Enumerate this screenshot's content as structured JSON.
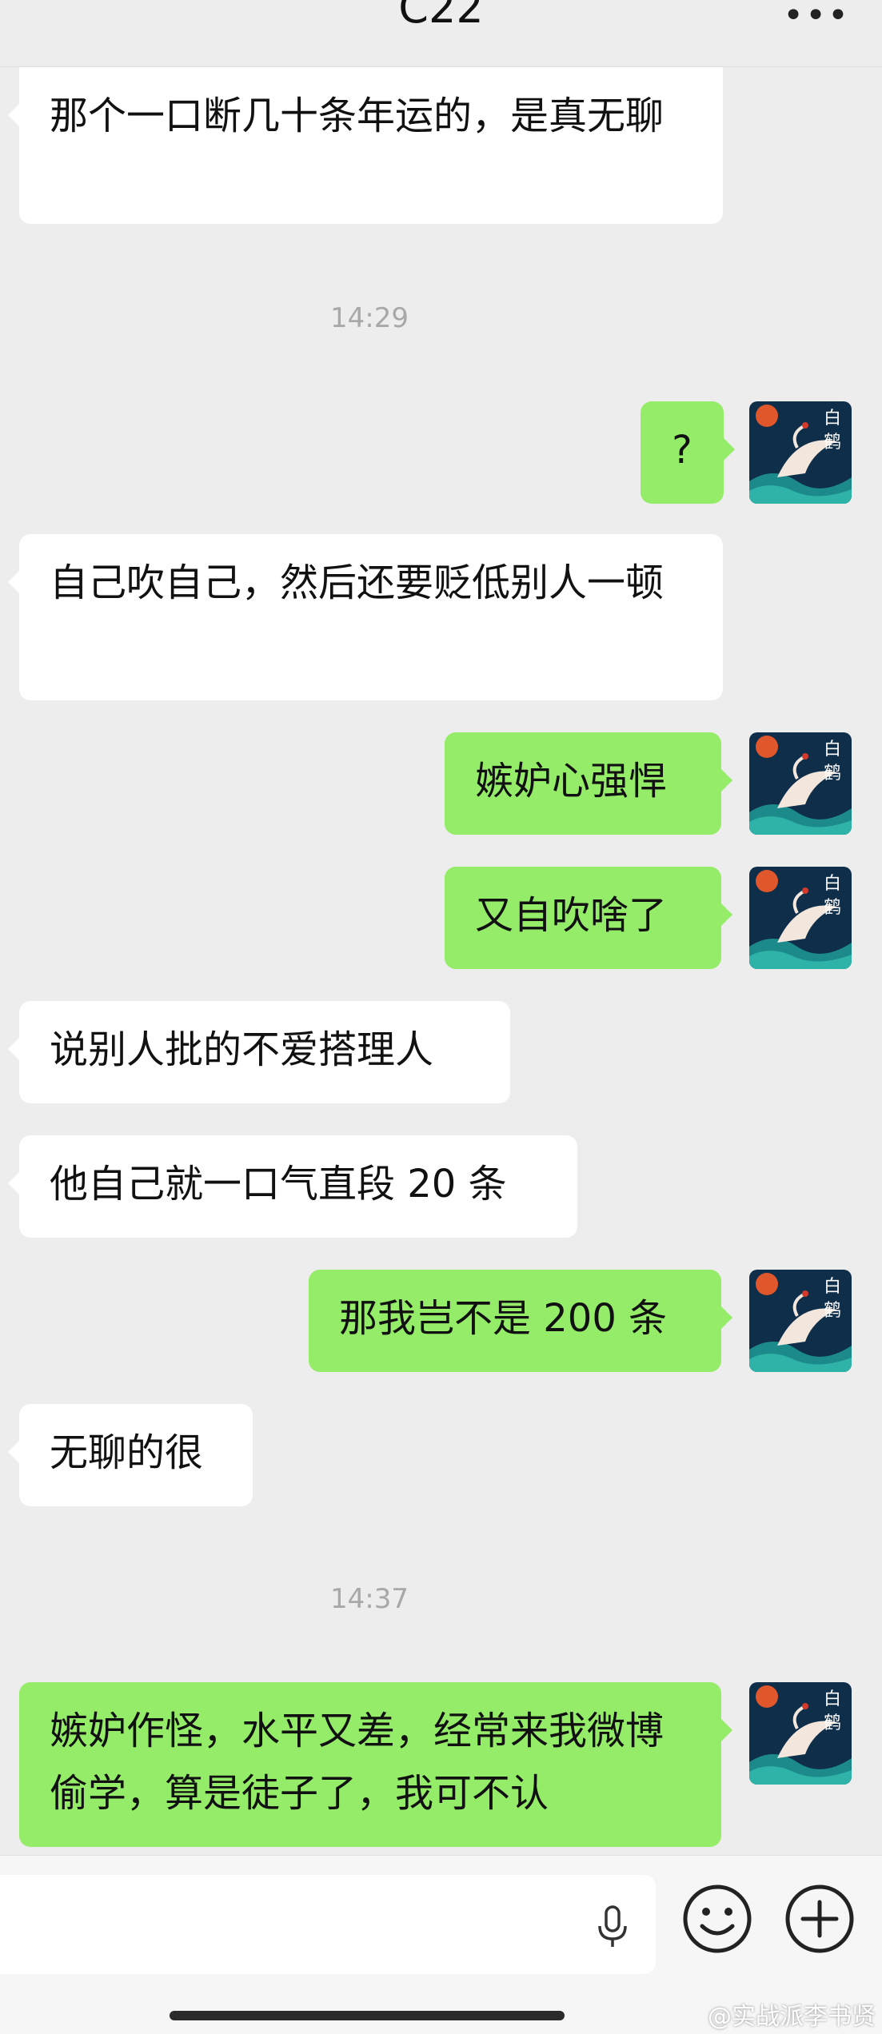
{
  "header": {
    "title": "C22",
    "more_icon": "more-dots-icon"
  },
  "messages": [
    {
      "text": "那个一口断几十条年运的，是真无聊",
      "from": "other"
    },
    {
      "time": "14:29"
    },
    {
      "text": "?",
      "from": "me"
    },
    {
      "text": "自己吹自己，然后还要贬低别人一顿",
      "from": "other"
    },
    {
      "text": "嫉妒心强悍",
      "from": "me"
    },
    {
      "text": "又自吹啥了",
      "from": "me"
    },
    {
      "text": "说别人批的不爱搭理人",
      "from": "other"
    },
    {
      "text": "他自己就一口气直段 20 条",
      "from": "other"
    },
    {
      "text": "那我岂不是 200 条",
      "from": "me"
    },
    {
      "text": "无聊的很",
      "from": "other"
    },
    {
      "time": "14:37"
    },
    {
      "text": "嫉妒作怪，水平又差，经常来我微博偷学，算是徒子了，我可不认",
      "from": "me"
    }
  ],
  "avatar": {
    "text": "白鹤",
    "icon": "crane-avatar-icon"
  },
  "input_bar": {
    "value": "",
    "icons": [
      "microphone-icon",
      "emoji-icon",
      "plus-icon"
    ]
  },
  "watermark": "@实战派李书贤",
  "colors": {
    "bg": "#ededed",
    "out_bubble": "#95ec69",
    "in_bubble": "#ffffff"
  }
}
